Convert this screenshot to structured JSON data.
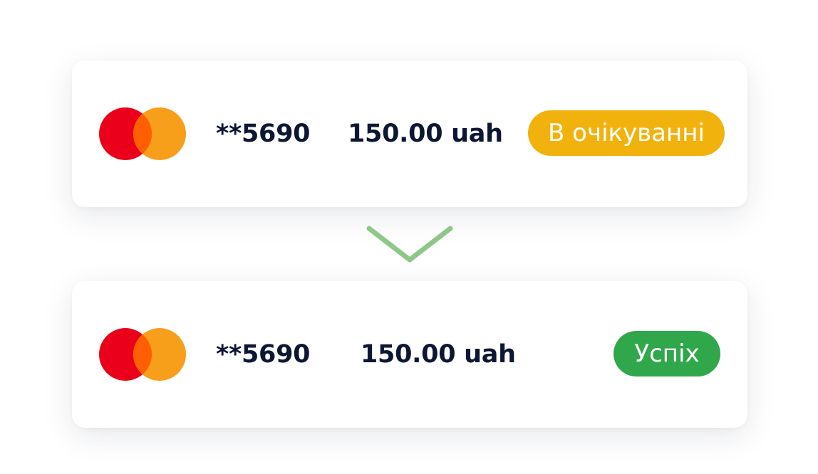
{
  "transactions": [
    {
      "card_number": "**5690",
      "amount": "150.00 uah",
      "status": "В очікуванні",
      "status_color": "#f2b20e"
    },
    {
      "card_number": "**5690",
      "amount": "150.00 uah",
      "status": "Успіх",
      "status_color": "#31a74c"
    }
  ],
  "card_brand_icon": "mastercard-logo-icon",
  "transition_icon": "chevron-down-icon",
  "colors": {
    "mastercard_red": "#eb001b",
    "mastercard_orange": "#f79e1b",
    "mastercard_overlap": "#ff5f00",
    "arrow": "#8fc78a",
    "text": "#0d1733"
  }
}
